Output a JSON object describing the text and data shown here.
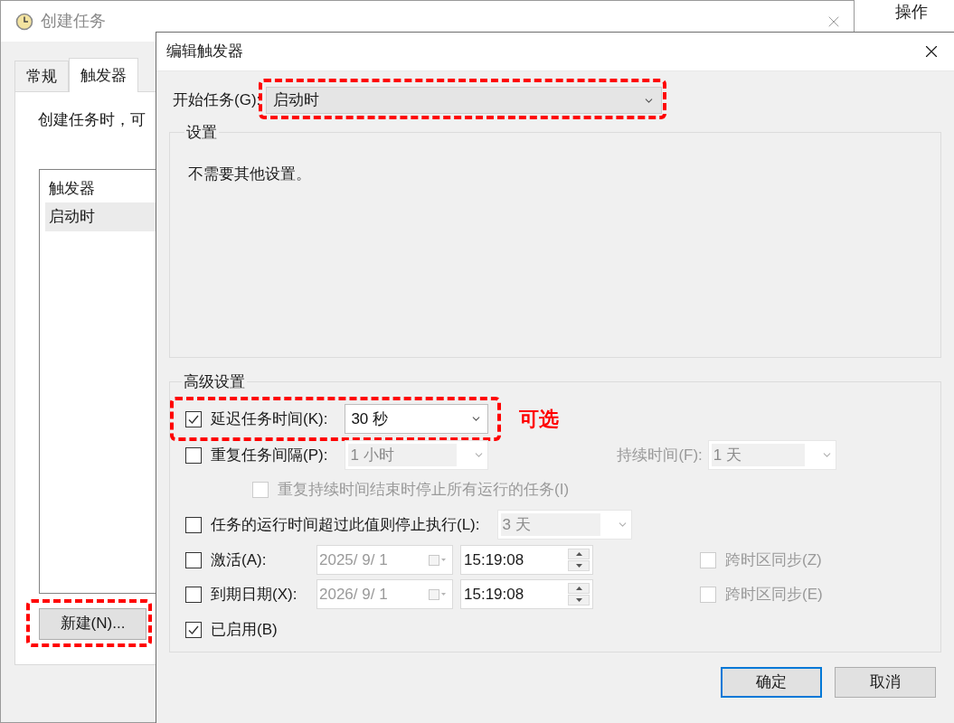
{
  "background_window": {
    "texts": [
      "操作"
    ]
  },
  "window": {
    "title": "创建任务",
    "tabs": [
      {
        "label": "常规",
        "selected": false
      },
      {
        "label": "触发器",
        "selected": true
      }
    ],
    "description": "创建任务时，可",
    "trigger_list": {
      "header": "触发器",
      "rows": [
        {
          "label": "启动时",
          "selected": true
        }
      ]
    },
    "new_button": {
      "label": "新建(N)...",
      "highlighted": true
    }
  },
  "dialog": {
    "title": "编辑触发器",
    "begin_task": {
      "label": "开始任务(G):",
      "value": "启动时",
      "highlighted": true
    },
    "settings": {
      "title": "设置",
      "text": "不需要其他设置。"
    },
    "advanced": {
      "title": "高级设置",
      "rows": [
        {
          "kind": "dropdown",
          "label": "延迟任务时间(K):",
          "checked": true,
          "value": "30 秒",
          "disabled": false,
          "highlighted": true,
          "note": "可选"
        },
        {
          "kind": "dropdown",
          "label": "重复任务间隔(P):",
          "checked": false,
          "value": "1 小时",
          "disabled": true,
          "highlighted": false,
          "extra": {
            "label": "持续时间(F):",
            "value": "1 天"
          }
        },
        {
          "kind": "subcheck",
          "label": "重复持续时间结束时停止所有运行的任务(I)",
          "checked": false,
          "disabled": true
        },
        {
          "kind": "dropdown",
          "label": "任务的运行时间超过此值则停止执行(L):",
          "checked": false,
          "value": "3 天",
          "disabled": true,
          "highlighted": false
        },
        {
          "kind": "datetime",
          "label": "激活(A):",
          "checked": false,
          "date": "2025/ 9/ 1",
          "time": "15:19:08",
          "sync": {
            "label": "跨时区同步(Z)",
            "checked": false
          }
        },
        {
          "kind": "datetime",
          "label": "到期日期(X):",
          "checked": false,
          "date": "2026/ 9/ 1",
          "time": "15:19:08",
          "sync": {
            "label": "跨时区同步(E)",
            "checked": false
          }
        },
        {
          "kind": "check",
          "label": "已启用(B)",
          "checked": true
        }
      ]
    },
    "buttons": [
      {
        "label": "确定",
        "default": true
      },
      {
        "label": "取消",
        "default": false
      }
    ]
  }
}
